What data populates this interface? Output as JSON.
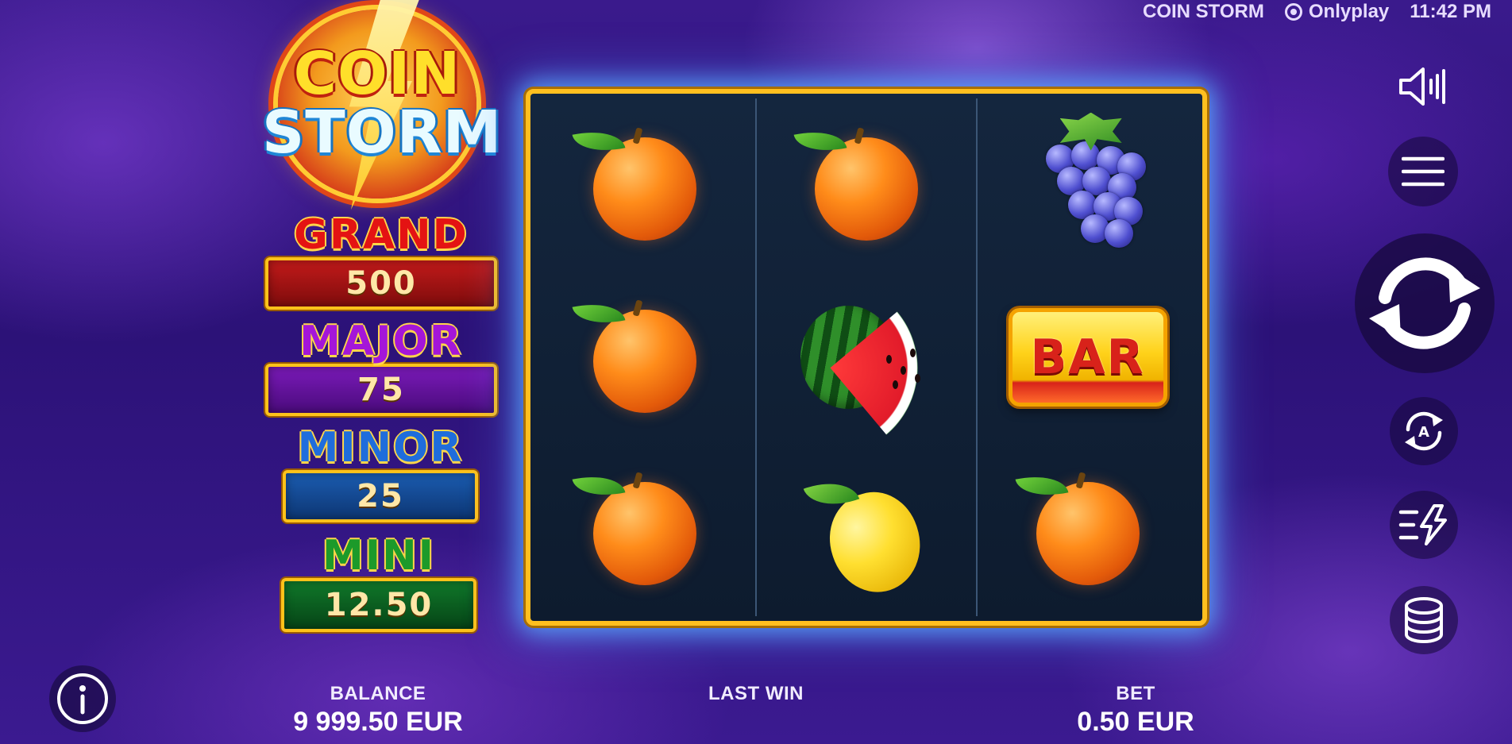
{
  "status_bar": {
    "game_name": "COIN STORM",
    "provider": "Onlyplay",
    "time": "11:42 PM"
  },
  "logo": {
    "line1": "COIN",
    "line2": "STORM"
  },
  "jackpots": [
    {
      "name": "GRAND",
      "value": "500",
      "color": "#e41313"
    },
    {
      "name": "MAJOR",
      "value": "75",
      "color": "#a416d9"
    },
    {
      "name": "MINOR",
      "value": "25",
      "color": "#1f6ddc"
    },
    {
      "name": "MINI",
      "value": "12.50",
      "color": "#1c9a2a"
    }
  ],
  "reels": [
    [
      "orange",
      "orange",
      "orange"
    ],
    [
      "orange",
      "watermelon",
      "lemon"
    ],
    [
      "grapes",
      "bar",
      "orange"
    ]
  ],
  "bar_symbol_text": "BAR",
  "controls": {
    "sound": "speaker-icon",
    "menu": "hamburger-menu-icon",
    "spin": "spin-arrows-icon",
    "autoplay": "autoplay-icon",
    "turbo": "turbo-lightning-icon",
    "bet": "coin-stack-icon",
    "info": "info-icon"
  },
  "bottom": {
    "balance_label": "BALANCE",
    "balance_value": "9 999.50 EUR",
    "lastwin_label": "LAST WIN",
    "lastwin_value": "",
    "bet_label": "BET",
    "bet_value": "0.50 EUR"
  },
  "colors": {
    "frame_gold": "#ffbf1f",
    "frame_glow": "#5aaaff",
    "background": "#2c1278"
  }
}
